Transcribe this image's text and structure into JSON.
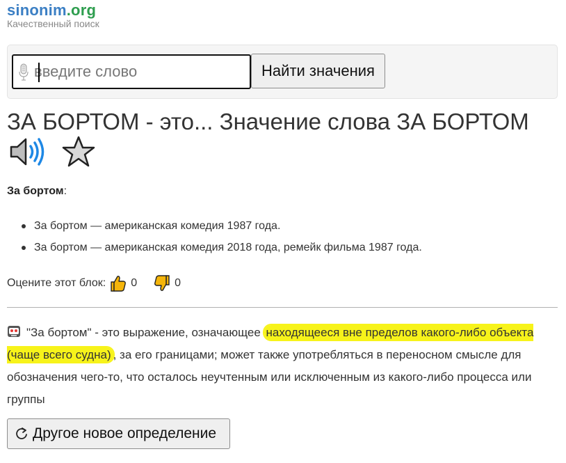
{
  "header": {
    "logo_part1": "sinonim",
    "logo_part2": ".org",
    "tagline": "Качественный поиск"
  },
  "search": {
    "placeholder": "введите слово",
    "button_label": "Найти значения",
    "icons": {
      "mic": "microphone-icon"
    }
  },
  "title": "ЗА БОРТОМ - это... Значение слова ЗА БОРТОМ",
  "title_icons": [
    "speaker-icon",
    "star-icon"
  ],
  "term": {
    "word": "За бортом",
    "colon": ":"
  },
  "definitions": [
    "За бортом — американская комедия 1987 года.",
    "За бортом — американская комедия 2018 года, ремейк фильма 1987 года."
  ],
  "rating": {
    "label": "Оцените этот блок:",
    "likes": "0",
    "dislikes": "0"
  },
  "description": {
    "part1": "\"За бортом\" - это выражение, означающее ",
    "highlight": "находящееся вне пределов какого-либо объекта (чаще всего судна)",
    "part2": ", за его границами; может также употребляться в переносном смысле для обозначения чего-то, что осталось неучтенным или исключенным из какого-либо процесса или группы"
  },
  "new_definition_button": "Другое новое определение",
  "colors": {
    "logo_blue": "#3b7fc4",
    "logo_green": "#2f9e4f",
    "highlight": "#f7f31a",
    "thumb": "#f5b50a",
    "speaker_wave": "#1e88e5"
  }
}
